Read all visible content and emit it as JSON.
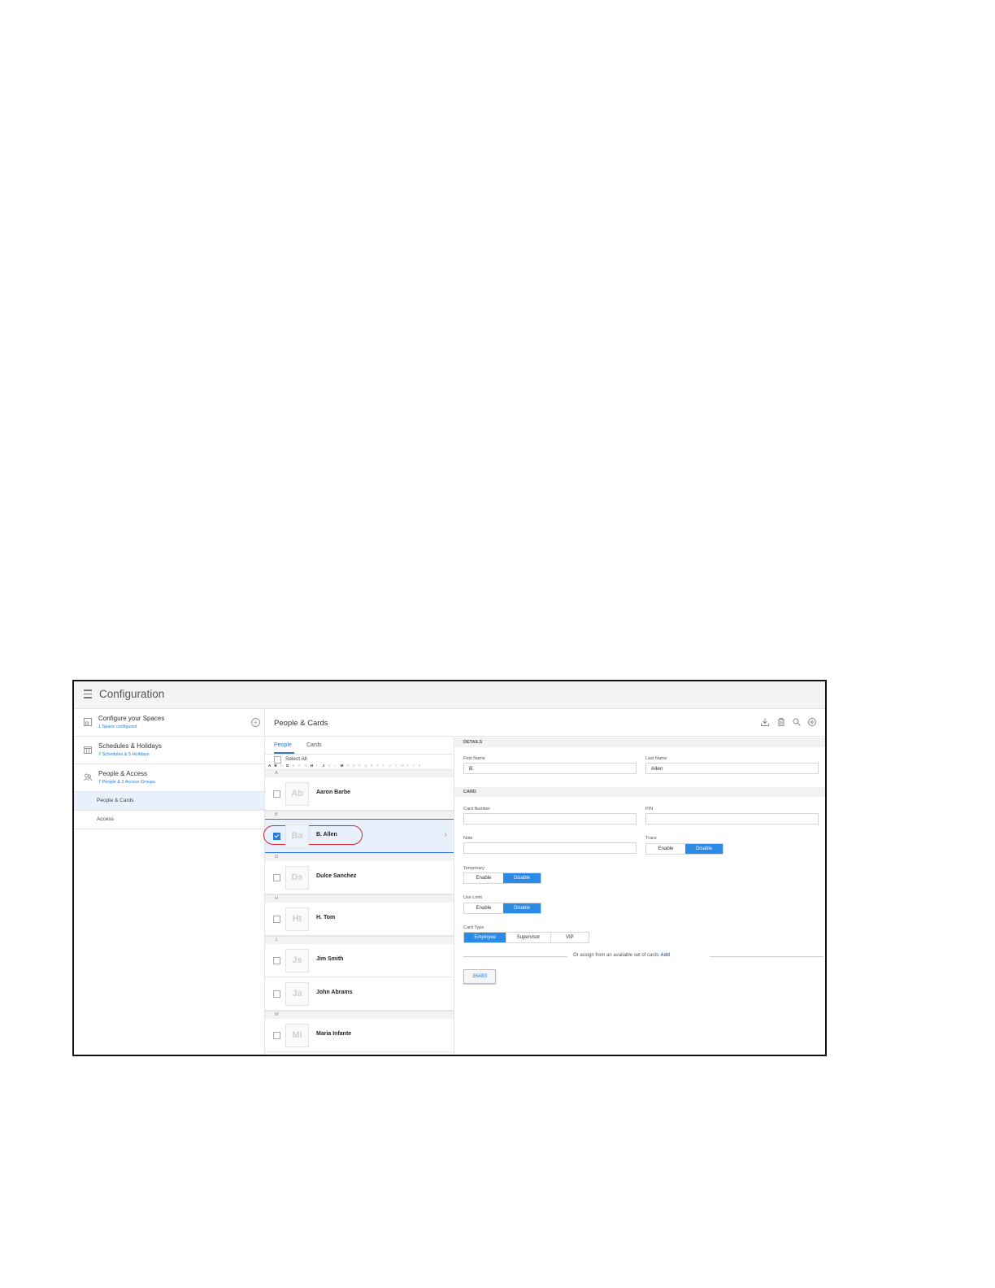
{
  "app": {
    "title": "Configuration"
  },
  "nav": {
    "groups": [
      {
        "title": "Configure your Spaces",
        "sub": "1 Space configured"
      },
      {
        "title": "Schedules & Holidays",
        "sub": "7 Schedules & 5 Holidays"
      },
      {
        "title": "People & Access",
        "sub": "7 People & 3 Access Groups"
      }
    ],
    "items": [
      {
        "label": "People & Cards"
      },
      {
        "label": "Access"
      }
    ]
  },
  "content": {
    "title": "People & Cards"
  },
  "list": {
    "tabs": [
      "People",
      "Cards"
    ],
    "select_all": "Select All",
    "alphabet": [
      "A",
      "B",
      "C",
      "D",
      "E",
      "F",
      "G",
      "H",
      "I",
      "J",
      "K",
      "L",
      "M",
      "N",
      "O",
      "P",
      "Q",
      "R",
      "S",
      "T",
      "U",
      "V",
      "W",
      "X",
      "Y",
      "Z"
    ],
    "sections": [
      "A",
      "B",
      "D",
      "H",
      "J",
      "M"
    ],
    "people": [
      {
        "initials": "Ab",
        "name": "Aaron Barbe"
      },
      {
        "initials": "Ba",
        "name": "B. Allen"
      },
      {
        "initials": "Ds",
        "name": "Dulce Sanchez"
      },
      {
        "initials": "Ht",
        "name": "H. Tom"
      },
      {
        "initials": "Js",
        "name": "Jim Smith"
      },
      {
        "initials": "Ja",
        "name": "John Abrams"
      },
      {
        "initials": "Mi",
        "name": "Maria Infante"
      }
    ]
  },
  "details": {
    "details_header": "DETAILS",
    "first_name_label": "First Name",
    "first_name_value": "B.",
    "last_name_label": "Last Name",
    "last_name_value": "Allen",
    "card_header": "CARD",
    "card_number_label": "Card Number",
    "card_number_value": "",
    "pin_label": "PIN",
    "pin_value": "",
    "note_label": "Note",
    "note_value": "",
    "trace_label": "Trace",
    "temporary_label": "Temporary",
    "use_limit_label": "Use Limit",
    "enable": "Enable",
    "disable": "Disable",
    "card_type_label": "Card Type",
    "card_types": [
      "Employee",
      "Supervisor",
      "VIP"
    ],
    "assign_text": "Or assign from an available set of cards",
    "assign_add": "Add",
    "card_chip": "36483"
  },
  "colors": {
    "accent": "#2b8ae6",
    "highlight_oval": "#d6262e",
    "selected_row": "#e8f1fb"
  }
}
